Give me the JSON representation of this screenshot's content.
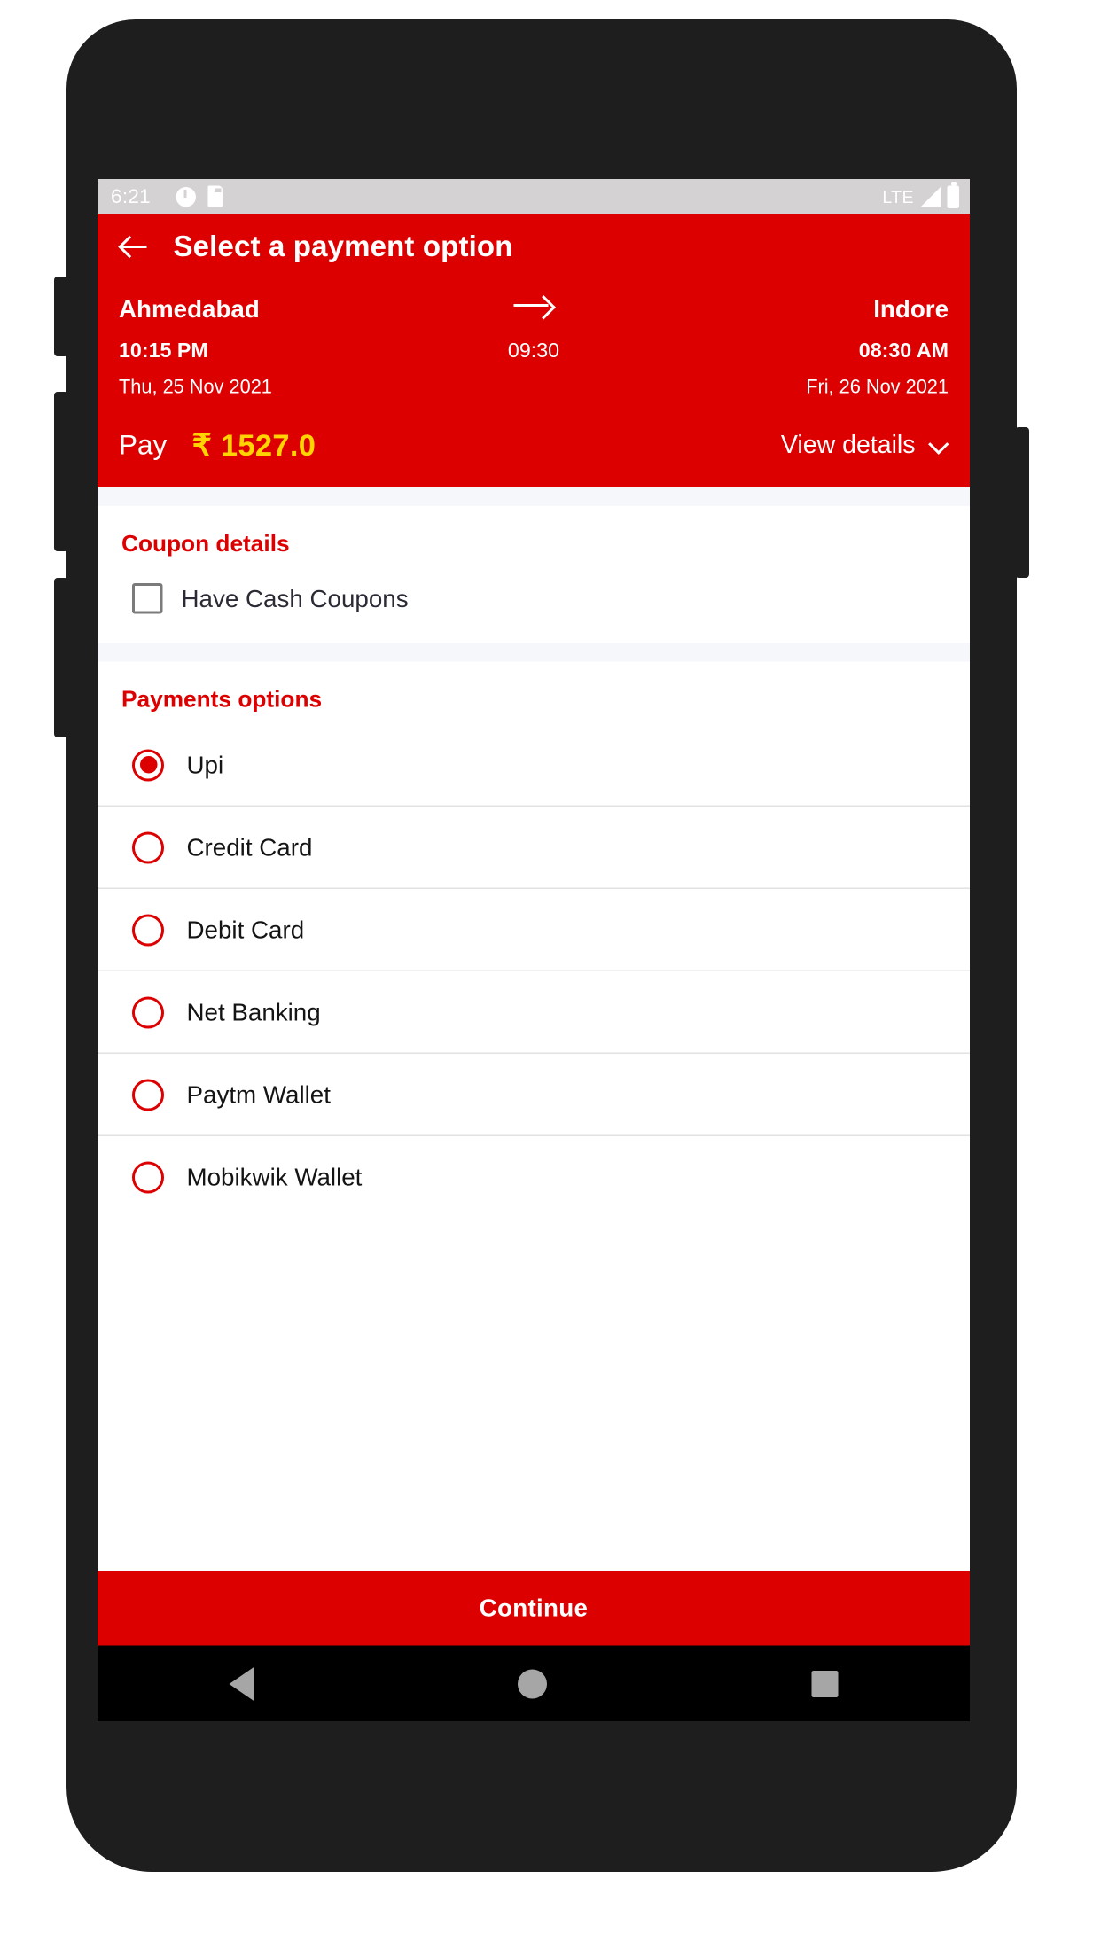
{
  "status_bar": {
    "time": "6:21",
    "icons": [
      "alarm-icon",
      "sd-card-icon"
    ],
    "network_label": "LTE",
    "right_icons": [
      "signal-icon",
      "battery-icon"
    ]
  },
  "appbar": {
    "back_icon": "back-arrow-icon",
    "title": "Select a payment option",
    "background_color": "#dd0000"
  },
  "journey": {
    "from_city": "Ahmedabad",
    "to_city": "Indore",
    "arrow_icon": "arrow-right-icon",
    "depart_time": "10:15 PM",
    "duration": "09:30",
    "arrive_time": "08:30 AM",
    "depart_date": "Thu, 25 Nov 2021",
    "arrive_date": "Fri, 26 Nov 2021"
  },
  "pay_bar": {
    "label": "Pay",
    "amount": "₹ 1527.0",
    "amount_color": "#ffd400",
    "view_details_label": "View details",
    "chevron_icon": "chevron-down-icon"
  },
  "coupon_section": {
    "title": "Coupon details",
    "checkbox_label": "Have Cash Coupons",
    "checked": false
  },
  "payments_section": {
    "title": "Payments options",
    "options": [
      {
        "label": "Upi",
        "selected": true
      },
      {
        "label": "Credit Card",
        "selected": false
      },
      {
        "label": "Debit Card",
        "selected": false
      },
      {
        "label": "Net Banking",
        "selected": false
      },
      {
        "label": "Paytm Wallet",
        "selected": false
      },
      {
        "label": "Mobikwik Wallet",
        "selected": false
      }
    ],
    "accent_color": "#dd0000"
  },
  "continue_button": {
    "label": "Continue"
  },
  "nav_bar": {
    "back_icon": "nav-back-triangle-icon",
    "home_icon": "nav-home-circle-icon",
    "recents_icon": "nav-recents-square-icon"
  }
}
